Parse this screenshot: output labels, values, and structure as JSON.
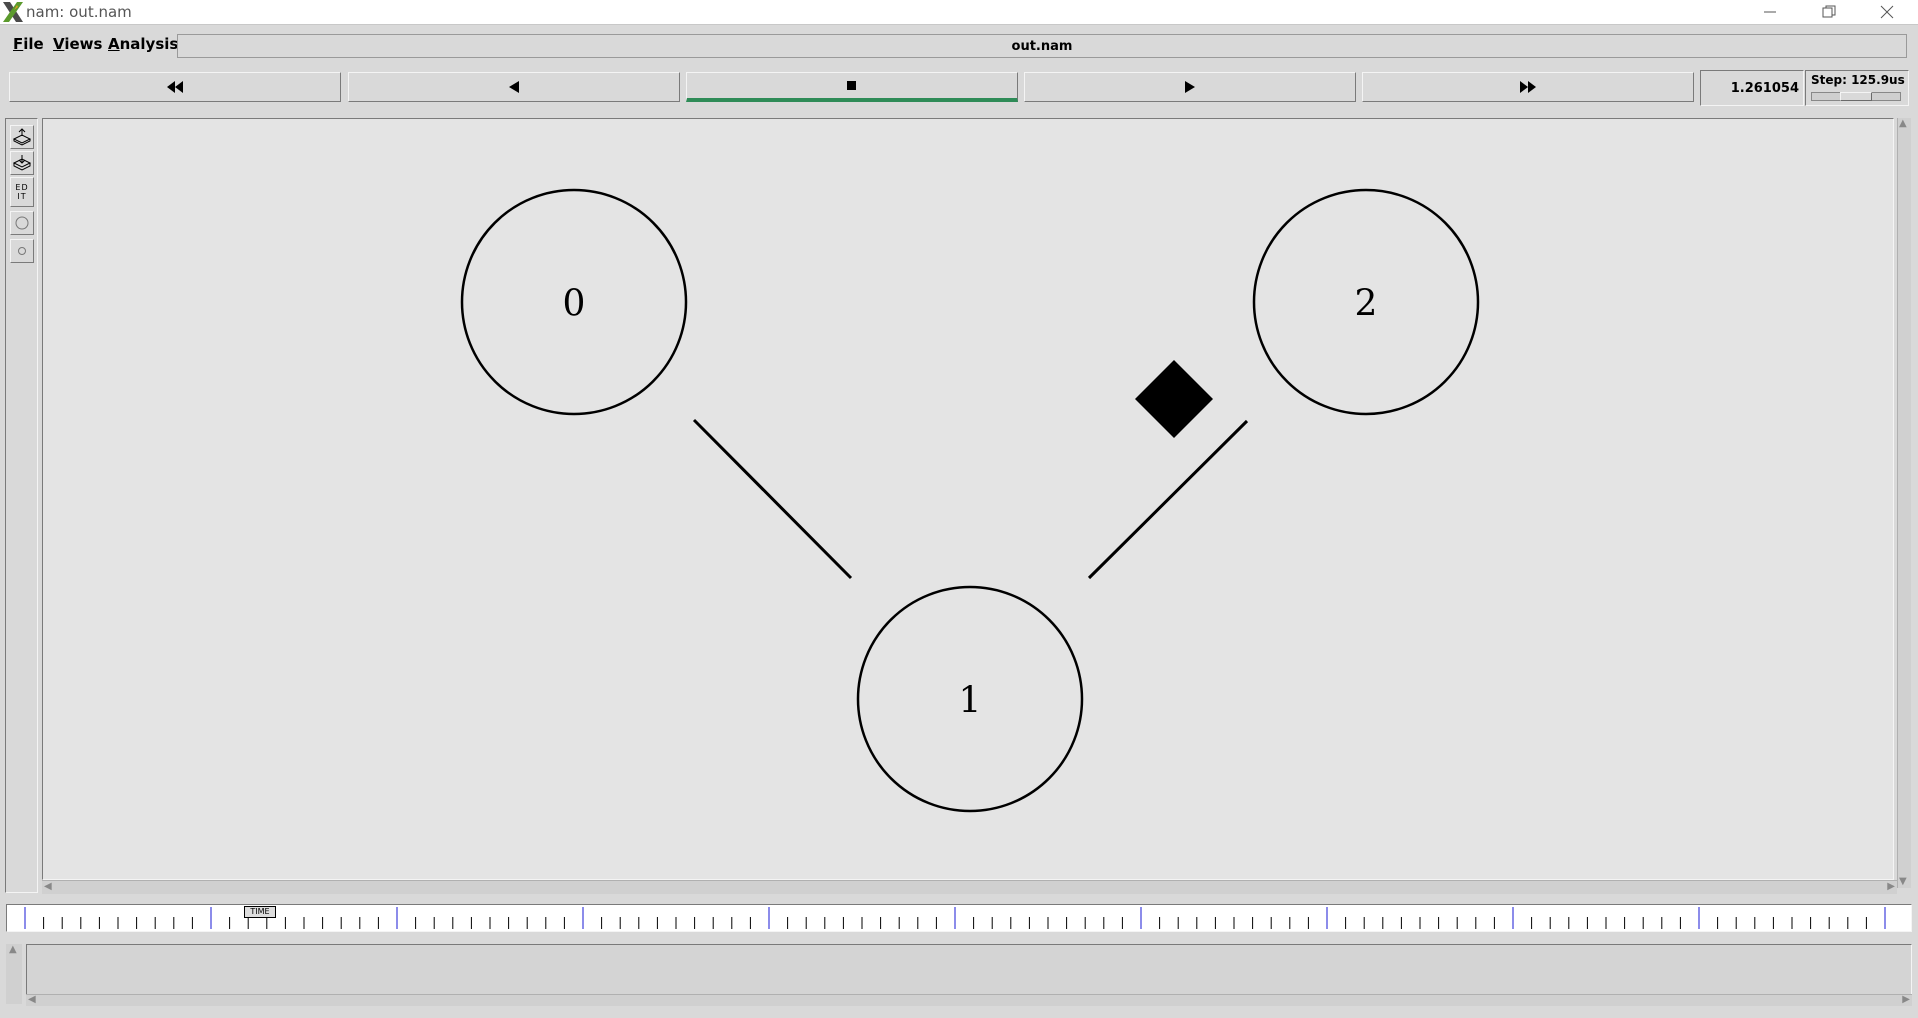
{
  "window": {
    "title": "nam: out.nam",
    "app_icon": "x-logo-icon",
    "controls": [
      "minimize-icon",
      "restore-icon",
      "close-icon"
    ]
  },
  "menu": {
    "items": [
      {
        "label": "File",
        "mnemonic": "F"
      },
      {
        "label": "Views",
        "mnemonic": "V"
      },
      {
        "label": "Analysis",
        "mnemonic": "A"
      }
    ],
    "file_name": "out.nam"
  },
  "transport": {
    "buttons": [
      {
        "name": "fast-rewind",
        "icon": "fast-rewind-icon"
      },
      {
        "name": "play-backward",
        "icon": "play-backward-icon"
      },
      {
        "name": "stop",
        "icon": "stop-icon",
        "active": true
      },
      {
        "name": "play-forward",
        "icon": "play-forward-icon"
      },
      {
        "name": "fast-forward",
        "icon": "fast-forward-icon"
      }
    ],
    "active_color": "#2e8b57",
    "current_time": "1.261054",
    "step_label": "Step: 125.9us"
  },
  "tools": {
    "edit_label": "ED IT",
    "icons": [
      "zoom-in-icon",
      "zoom-out-icon",
      "edit-icon",
      "node-circle-icon",
      "small-circle-icon"
    ]
  },
  "topology": {
    "nodes": [
      {
        "id": "0",
        "label": "0"
      },
      {
        "id": "1",
        "label": "1"
      },
      {
        "id": "2",
        "label": "2"
      }
    ],
    "links": [
      {
        "from": "0",
        "to": "1"
      },
      {
        "from": "1",
        "to": "2"
      }
    ],
    "packets": [
      {
        "link": "1-2",
        "shape": "diamond",
        "color": "#000000"
      }
    ],
    "canvas_background": "#e4e4e4"
  },
  "timeline": {
    "marker_label": "TIME",
    "major_tick_color": "#1a1ad6",
    "minor_tick_color": "#000000"
  }
}
